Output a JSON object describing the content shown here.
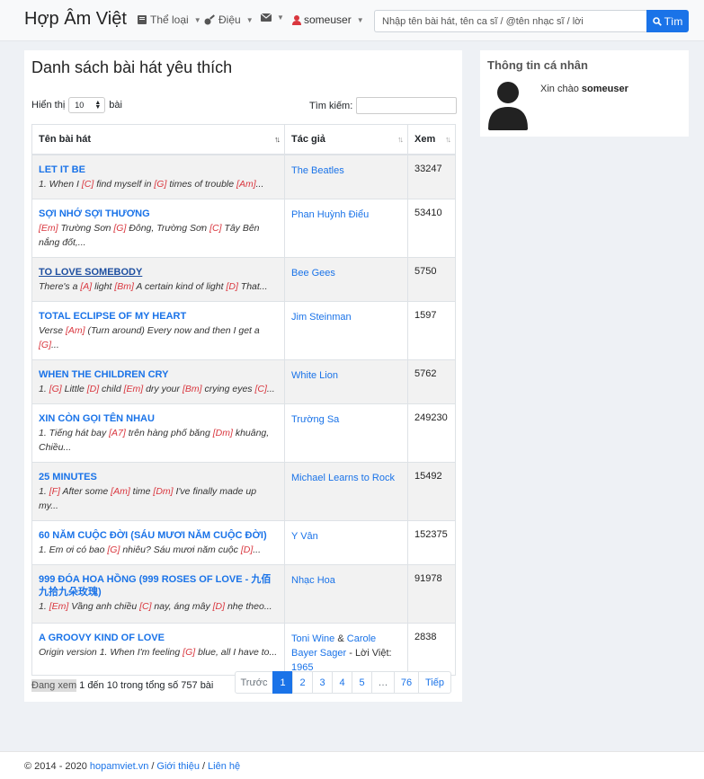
{
  "nav": {
    "brand": "Hợp Âm Việt",
    "genre_label": "Thể loại",
    "rhythm_label": "Điệu",
    "username": "someuser",
    "search_placeholder": "Nhập tên bài hát, tên ca sĩ / @tên nhạc sĩ / lời",
    "search_button": "Tìm",
    "accent_color": "#1a73e8"
  },
  "main": {
    "title": "Danh sách bài hát yêu thích",
    "length_prefix": "Hiển thị",
    "length_value": "10",
    "length_suffix": "bài",
    "filter_label": "Tìm kiếm:",
    "columns": [
      "Tên bài hát",
      "Tác giả",
      "Xem"
    ],
    "rows": [
      {
        "title": "LET IT BE",
        "snippet": "1. When I [C] find myself in [G] times of trouble [Am]...",
        "author": "The Beatles",
        "views": "33247"
      },
      {
        "title": "SỢI NHỚ SỢI THƯƠNG",
        "snippet": "[Em] Trường Sơn [G] Đông, Trường Sơn [C] Tây Bên nắng đốt,...",
        "author": "Phan Huỳnh Điểu",
        "views": "53410"
      },
      {
        "title": "TO LOVE SOMEBODY",
        "snippet": "There's a [A] light [Bm] A certain kind of light [D] That...",
        "author": "Bee Gees",
        "views": "5750"
      },
      {
        "title": "TOTAL ECLIPSE OF MY HEART",
        "snippet": "Verse [Am] (Turn around) Every now and then I get a [G]...",
        "author": "Jim Steinman",
        "views": "1597"
      },
      {
        "title": "WHEN THE CHILDREN CRY",
        "snippet": "1. [G] Little [D] child [Em] dry your [Bm] crying eyes [C]...",
        "author": "White Lion",
        "views": "5762"
      },
      {
        "title": "XIN CÒN GỌI TÊN NHAU",
        "snippet": "1. Tiếng hát bay [A7] trên hàng phố băng [Dm] khuâng, Chiều...",
        "author": "Trường Sa",
        "views": "249230"
      },
      {
        "title": "25 MINUTES",
        "snippet": "1. [F] After some [Am] time [Dm] I've finally made up my...",
        "author": "Michael Learns to Rock",
        "views": "15492"
      },
      {
        "title": "60 NĂM CUỘC ĐỜI (SÁU MƯƠI NĂM CUỘC ĐỜI)",
        "snippet": "1. Em ơi có bao [G] nhiêu? Sáu mươi năm cuộc [D]...",
        "author": "Y Vân",
        "views": "152375"
      },
      {
        "title": "999 ĐÓA HOA HỒNG (999 ROSES OF LOVE - 九佰九拾九朵玫瑰)",
        "snippet": "1. [Em] Vầng anh chiều [C] nay, áng mây [D] nhẹ theo...",
        "author": "Nhạc Hoa",
        "views": "91978"
      },
      {
        "title": "A GROOVY KIND OF LOVE",
        "snippet": "Origin version 1. When I'm feeling [G] blue, all I have to...",
        "author_a": "Toni Wine",
        "author_amp": "&",
        "author_b": "Carole Bayer Sager",
        "author_mid": "- Lời Việt:",
        "author_c": "1965",
        "views": "2838"
      }
    ],
    "info_prefix": "Đang xem",
    "info_rest": "1 đến 10 trong tổng số 757 bài",
    "pager": [
      "Trước",
      "1",
      "2",
      "3",
      "4",
      "5",
      "…",
      "76",
      "Tiếp"
    ]
  },
  "sidebar": {
    "title": "Thông tin cá nhân",
    "greeting": "Xin chào",
    "username": "someuser"
  },
  "footer": {
    "copyright": "© 2014 - 2020",
    "site_link": "hopamviet.vn",
    "sep1": "/",
    "about_link": "Giới thiệu",
    "sep2": "/",
    "contact_link": "Liên hệ"
  }
}
